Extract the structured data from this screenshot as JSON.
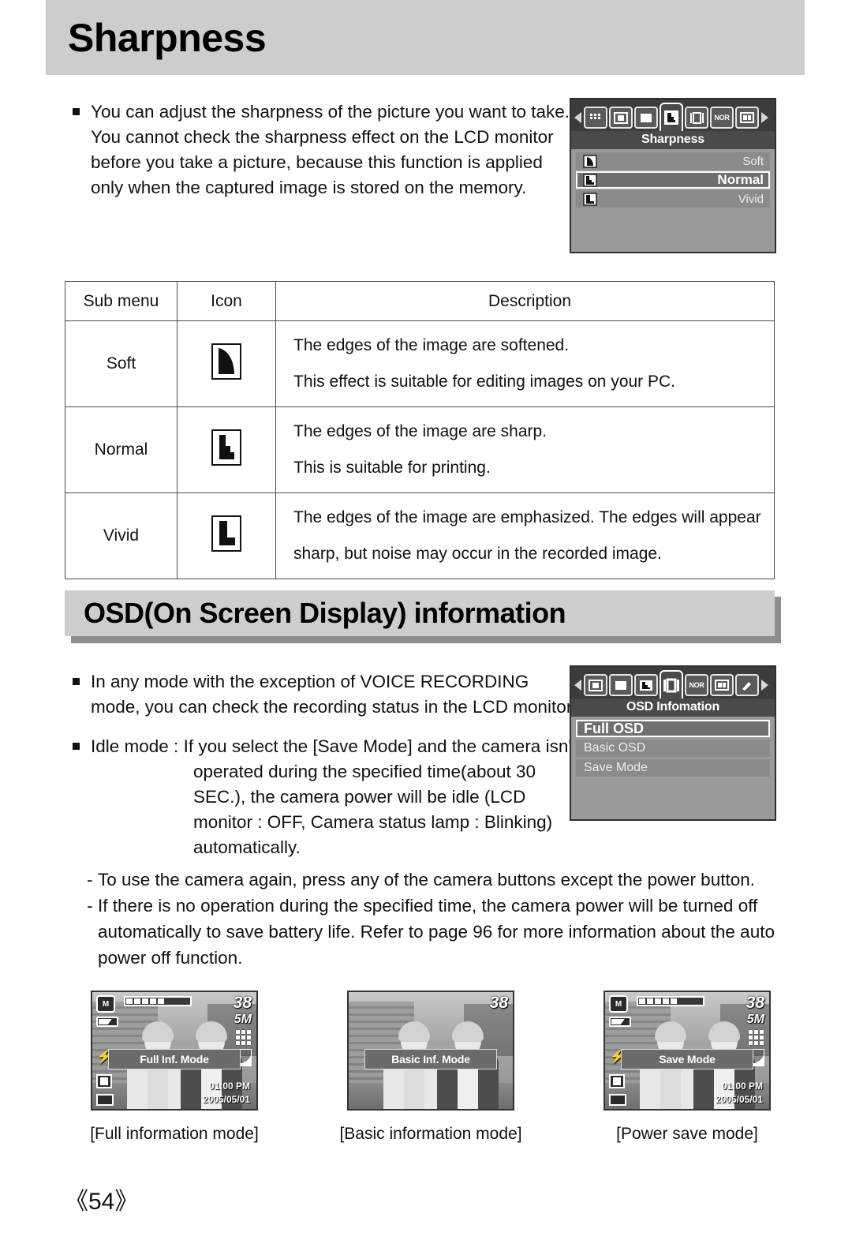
{
  "sections": {
    "sharpness": {
      "title": "Sharpness",
      "intro": [
        "You can adjust the sharpness of the picture you want to take.",
        "You cannot check the sharpness effect on the LCD monitor",
        "before you take a picture, because this function is applied",
        "only when the captured image is stored on the memory."
      ],
      "lcd": {
        "menu_title": "Sharpness",
        "tabs": [
          {
            "name": "grid-icon",
            "label": ""
          },
          {
            "name": "frame-icon",
            "label": ""
          },
          {
            "name": "white-square-icon",
            "label": ""
          },
          {
            "name": "sharpness-icon",
            "label": "",
            "active": true
          },
          {
            "name": "osd-icon",
            "label": ""
          },
          {
            "name": "nor-icon",
            "label": "NOR"
          },
          {
            "name": "picture-icon",
            "label": ""
          }
        ],
        "items": [
          {
            "label": "Soft",
            "icon": "sharpness-soft-icon",
            "selected": false
          },
          {
            "label": "Normal",
            "icon": "sharpness-normal-icon",
            "selected": true
          },
          {
            "label": "Vivid",
            "icon": "sharpness-vivid-icon",
            "selected": false
          }
        ]
      },
      "table": {
        "headers": [
          "Sub menu",
          "Icon",
          "Description"
        ],
        "rows": [
          {
            "sub_menu": "Soft",
            "icon": "sharpness-soft-icon",
            "description": [
              "The edges of the image are softened.",
              "This effect is suitable for editing images on your PC."
            ]
          },
          {
            "sub_menu": "Normal",
            "icon": "sharpness-normal-icon",
            "description": [
              "The edges of the image are sharp.",
              "This is suitable for printing."
            ]
          },
          {
            "sub_menu": "Vivid",
            "icon": "sharpness-vivid-icon",
            "description": [
              "The edges of the image are emphasized. The edges will appear",
              "sharp, but noise may occur in the recorded image."
            ]
          }
        ]
      }
    },
    "osd": {
      "title": "OSD(On Screen Display) information",
      "bullets": [
        {
          "lines": [
            "In any mode with the exception of VOICE RECORDING",
            "mode, you can check the recording status in the LCD monitor."
          ],
          "indented": []
        },
        {
          "lines": [
            "Idle mode : If you select the [Save Mode] and the camera isn't"
          ],
          "indented": [
            "operated during the specified time(about 30",
            "SEC.), the camera power will be idle (LCD",
            "monitor : OFF, Camera status lamp : Blinking)",
            "automatically."
          ]
        }
      ],
      "dashes": [
        {
          "lines": [
            "To use the camera again, press any of the camera buttons except the power button."
          ]
        },
        {
          "lines": [
            "If there is no operation during the specified time, the camera power will be turned off",
            "automatically to save battery life. Refer to page 96 for more information about the auto",
            "power off function."
          ]
        }
      ],
      "lcd": {
        "menu_title": "OSD Infomation",
        "tabs": [
          {
            "name": "frame-icon",
            "label": ""
          },
          {
            "name": "white-square-icon",
            "label": ""
          },
          {
            "name": "sharpness-icon",
            "label": ""
          },
          {
            "name": "osd-icon",
            "label": "",
            "active": true
          },
          {
            "name": "nor-icon",
            "label": "NOR"
          },
          {
            "name": "picture-icon",
            "label": ""
          },
          {
            "name": "pen-icon",
            "label": ""
          }
        ],
        "items": [
          {
            "label": "Full OSD",
            "selected": true
          },
          {
            "label": "Basic OSD",
            "selected": false
          },
          {
            "label": "Save Mode",
            "selected": false
          }
        ]
      },
      "previews": [
        {
          "mode_pill": "Full Inf. Mode",
          "caption": "[Full information mode]",
          "counter": "38",
          "resolution": "5M",
          "time": "01:00 PM",
          "date": "2005/05/01",
          "full_osd": true
        },
        {
          "mode_pill": "Basic Inf. Mode",
          "caption": "[Basic information mode]",
          "counter": "38",
          "resolution": "",
          "time": "",
          "date": "",
          "full_osd": false
        },
        {
          "mode_pill": "Save Mode",
          "caption": "[Power save mode]",
          "counter": "38",
          "resolution": "5M",
          "time": "01:00 PM",
          "date": "2005/05/01",
          "full_osd": true
        }
      ]
    }
  },
  "page_number": "《54》",
  "colors": {
    "header_bar": "#cdcdcd",
    "header_shadow": "#8d8d8d",
    "lcd_background": "#9a9a9a",
    "lcd_tabs": "#3c3c3c",
    "lcd_title": "#4a4a4a",
    "lcd_row": "#8b8b8b",
    "lcd_row_selected": "#6f6f6f"
  }
}
